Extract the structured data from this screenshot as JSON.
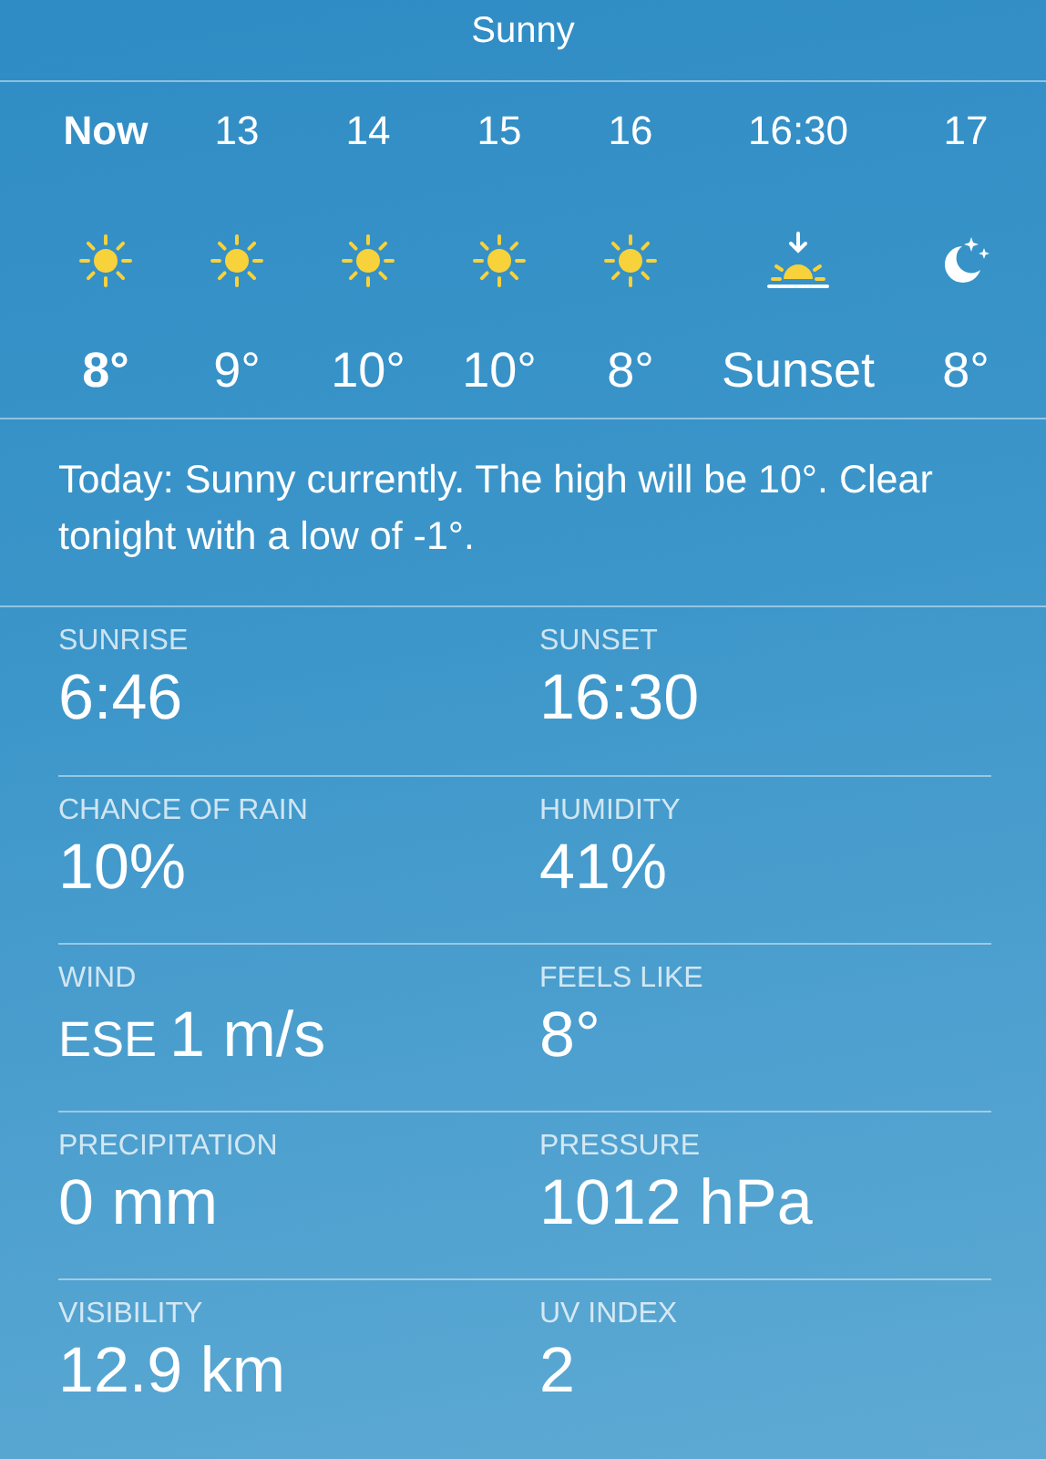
{
  "condition": "Sunny",
  "hourly": [
    {
      "time": "Now",
      "current": true,
      "kind": "sun",
      "temp": "8°"
    },
    {
      "time": "13",
      "current": false,
      "kind": "sun",
      "temp": "9°"
    },
    {
      "time": "14",
      "current": false,
      "kind": "sun",
      "temp": "10°"
    },
    {
      "time": "15",
      "current": false,
      "kind": "sun",
      "temp": "10°"
    },
    {
      "time": "16",
      "current": false,
      "kind": "sun",
      "temp": "8°"
    },
    {
      "time": "16:30",
      "current": false,
      "kind": "sunset",
      "temp": "Sunset"
    },
    {
      "time": "17",
      "current": false,
      "kind": "moon",
      "temp": "8°"
    }
  ],
  "summary": "Today: Sunny currently. The high will be 10°. Clear tonight with a low of -1°.",
  "details": [
    {
      "label": "SUNRISE",
      "value": "6:46"
    },
    {
      "label": "SUNSET",
      "value": "16:30"
    },
    {
      "label": "CHANCE OF RAIN",
      "value": "10%"
    },
    {
      "label": "HUMIDITY",
      "value": "41%"
    },
    {
      "label": "WIND",
      "prefix": "ESE",
      "value": "1 m/s"
    },
    {
      "label": "FEELS LIKE",
      "value": "8°"
    },
    {
      "label": "PRECIPITATION",
      "value": "0 mm"
    },
    {
      "label": "PRESSURE",
      "value": "1012 hPa"
    },
    {
      "label": "VISIBILITY",
      "value": "12.9 km"
    },
    {
      "label": "UV INDEX",
      "value": "2"
    }
  ]
}
